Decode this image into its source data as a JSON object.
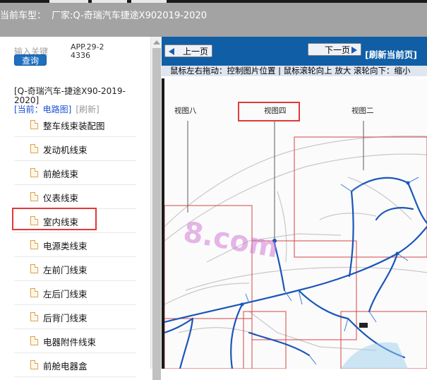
{
  "header": {
    "title_prefix": "当前车型：",
    "model": "厂家:Q-奇瑞汽车捷途X902019-2020"
  },
  "sidebar": {
    "search_label": "输入关键",
    "app_code": "APP.29-24336",
    "query_button": "查询",
    "car_name": "[Q-奇瑞汽车-捷途X90-2019-2020]",
    "current_label": "[当前：电路图]",
    "refresh_label": "[刷新]",
    "items": [
      {
        "label": "整车线束装配图"
      },
      {
        "label": "发动机线束"
      },
      {
        "label": "前舱线束"
      },
      {
        "label": "仪表线束"
      },
      {
        "label": "室内线束"
      },
      {
        "label": "电源类线束"
      },
      {
        "label": "左前门线束"
      },
      {
        "label": "左后门线束"
      },
      {
        "label": "后背门线束"
      },
      {
        "label": "电器附件线束"
      },
      {
        "label": "前舱电器盒"
      }
    ],
    "selected_item": "室内线束"
  },
  "viewer": {
    "prev_button": "上一页",
    "next_button": "下一页",
    "refresh_page": "[刷新当前页]",
    "hint": "鼠标左右拖动：控制图片位置 | 鼠标滚轮向上 放大  滚轮向下：缩小",
    "diagram_labels": {
      "view8": "视图八",
      "view4": "视图四",
      "view2": "视图二"
    },
    "watermark": "8.com"
  },
  "colors": {
    "header_bg": "#a3a3a3",
    "nav_bg": "#0f5ea6",
    "button_blue": "#1e6fc0",
    "highlight": "#e03a3a",
    "harness_blue": "#1a56b8"
  }
}
